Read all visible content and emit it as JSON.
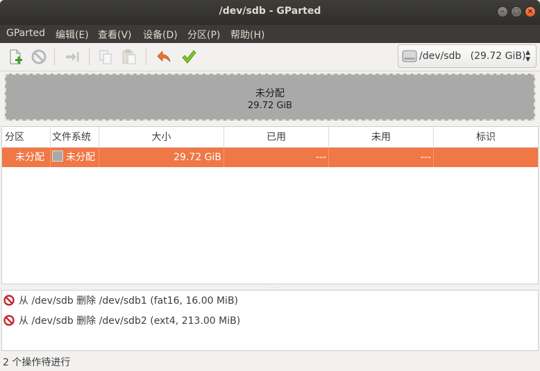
{
  "window": {
    "title": "/dev/sdb - GParted"
  },
  "menubar": {
    "items": [
      "GParted",
      "编辑(E)",
      "查看(V)",
      "设备(D)",
      "分区(P)",
      "帮助(H)"
    ]
  },
  "toolbar": {
    "buttons": [
      "new-partition",
      "delete",
      "resize-move",
      "copy",
      "paste",
      "undo",
      "apply"
    ]
  },
  "device_selector": {
    "label": "/dev/sdb   (29.72 GiB)"
  },
  "disk_map": {
    "label": "未分配",
    "size": "29.72 GiB",
    "color": "#a9a9a9"
  },
  "partition_table": {
    "columns": [
      "分区",
      "文件系统",
      "大小",
      "已用",
      "未用",
      "标识"
    ],
    "rows": [
      {
        "partition": "未分配",
        "filesystem": "未分配",
        "size": "29.72 GiB",
        "used": "---",
        "unused": "---",
        "flags": ""
      }
    ],
    "selected_color": "#f07746"
  },
  "pending_operations": [
    "从 /dev/sdb 删除 /dev/sdb1 (fat16, 16.00 MiB)",
    "从 /dev/sdb 删除 /dev/sdb2 (ext4, 213.00 MiB)"
  ],
  "status": {
    "text": "2 个操作待进行"
  }
}
